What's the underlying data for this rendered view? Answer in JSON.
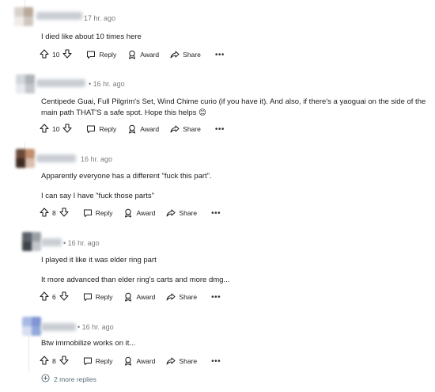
{
  "comments": [
    {
      "time": "17 hr. ago",
      "body": [
        "I died like about 10 times here"
      ],
      "votes": "10",
      "avatar_colors": [
        "#d9d2cc",
        "#b9a99b",
        "#efece8",
        "#cfc7bf"
      ]
    },
    {
      "time": "16 hr. ago",
      "body": [
        "Centipede Guai, Full Pilgrim's Set, Wind Chime curio (if you have it). And also, if there's a yaoguai on the side of the main path THAT'S a safe spot. Hope this helps 😊"
      ],
      "votes": "10",
      "avatar_colors": [
        "#d3d6da",
        "#aeb3b8",
        "#e8eaed",
        "#c3c7cc"
      ]
    },
    {
      "time": "16 hr. ago",
      "body": [
        "Apparently everyone has a different \"fuck this part\".",
        "I can say I have \"fuck those parts\""
      ],
      "votes": "8",
      "avatar_colors": [
        "#6b4a3a",
        "#c28e6d",
        "#3d2b22",
        "#d9bfae"
      ]
    },
    {
      "time": "16 hr. ago",
      "body": [
        "I played it like it was elder ring part",
        "It more advanced than elder ring's carts and more dmg..."
      ],
      "votes": "6",
      "avatar_colors": [
        "#5b6168",
        "#9aa0a6",
        "#3f444a",
        "#c4c8cc"
      ]
    },
    {
      "time": "16 hr. ago",
      "body": [
        "Btw immobilize works on it..."
      ],
      "votes": "8",
      "avatar_colors": [
        "#a9b9e4",
        "#7f96d4",
        "#d6deef",
        "#93a8dc"
      ]
    }
  ],
  "actions": {
    "reply": "Reply",
    "award": "Award",
    "share": "Share",
    "more": "•••"
  },
  "more_replies": "2 more replies"
}
